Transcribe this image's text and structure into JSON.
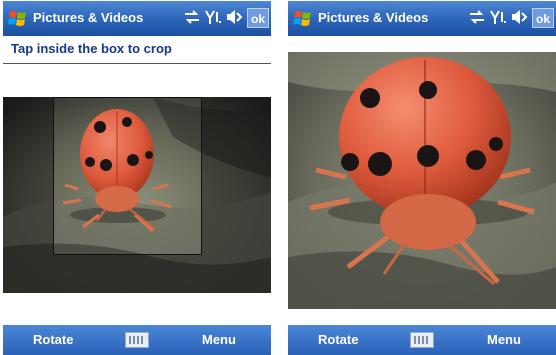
{
  "left_screen": {
    "title": "Pictures & Videos",
    "ok_label": "ok",
    "instruction": "Tap inside the box to crop",
    "softkey_left": "Rotate",
    "softkey_right": "Menu"
  },
  "right_screen": {
    "title": "Pictures & Videos",
    "ok_label": "ok",
    "softkey_left": "Rotate",
    "softkey_right": "Menu"
  },
  "status_icons": [
    "connectivity-icon",
    "signal-icon",
    "volume-icon"
  ],
  "colors": {
    "titlebar": "#2b64b8",
    "instruction_text": "#15388f",
    "ladybug": "#e0573e",
    "spots": "#1b1414"
  }
}
